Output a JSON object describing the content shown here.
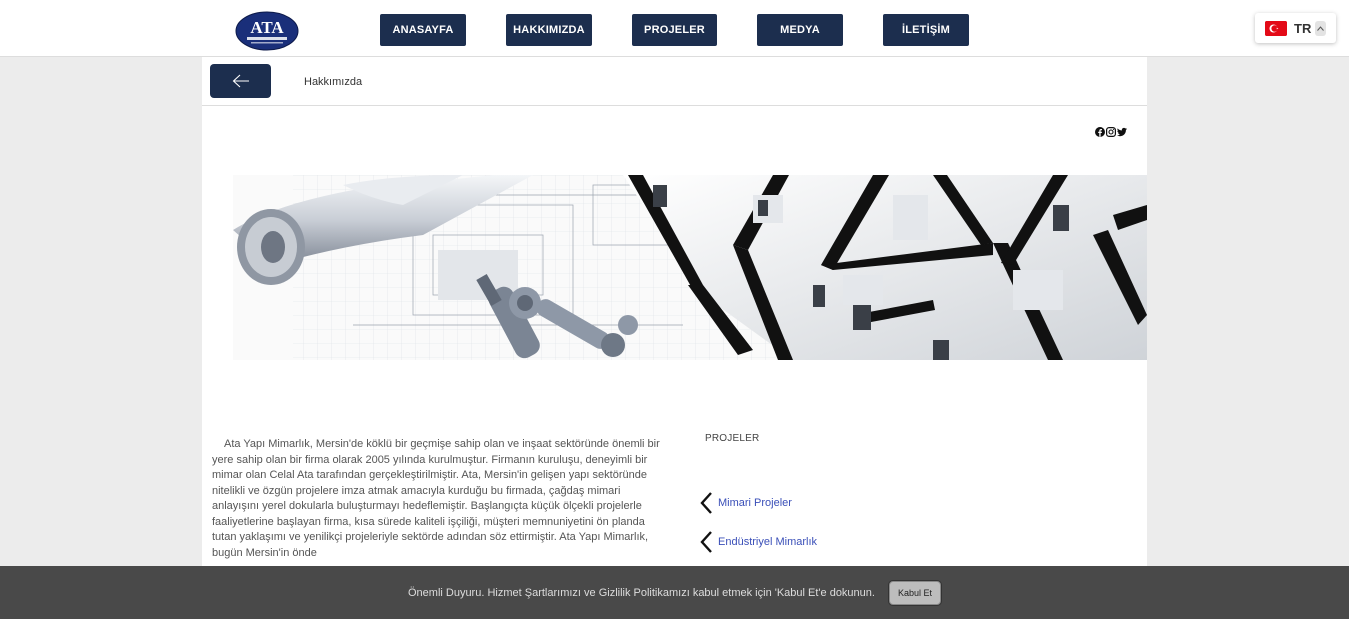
{
  "logo": {
    "text": "ATA",
    "subtext": "YAPI • MİMARLIK"
  },
  "nav": [
    {
      "label": "ANASAYFA"
    },
    {
      "label": "HAKKIMIZDA"
    },
    {
      "label": "PROJELER"
    },
    {
      "label": "MEDYA"
    },
    {
      "label": "İLETİŞİM"
    }
  ],
  "language": {
    "code": "TR",
    "flag": "turkey-flag-icon"
  },
  "breadcrumb": {
    "title": "Hakkımızda"
  },
  "social_icons": [
    "facebook-icon",
    "instagram-icon",
    "twitter-icon"
  ],
  "about": {
    "text": "Ata Yapı Mimarlık, Mersin'de köklü bir geçmişe sahip olan ve inşaat sektöründe önemli bir yere sahip olan bir firma olarak 2005 yılında kurulmuştur. Firmanın kuruluşu, deneyimli bir mimar olan Celal Ata tarafından gerçekleştirilmiştir. Ata, Mersin'in gelişen yapı sektöründe nitelikli ve özgün projelere imza atmak amacıyla kurduğu bu firmada, çağdaş mimari anlayışını yerel dokularla buluşturmayı hedeflemiştir. Başlangıçta küçük ölçekli projelerle faaliyetlerine başlayan firma, kısa sürede kaliteli işçiliği, müşteri memnuniyetini ön planda tutan yaklaşımı ve yenilikçi projeleriyle sektörde adından söz ettirmiştir. Ata Yapı Mimarlık, bugün Mersin'in önde"
  },
  "projects": {
    "title": "PROJELER",
    "links": [
      {
        "label": "Mimari Projeler"
      },
      {
        "label": "Endüstriyel Mimarlık"
      }
    ]
  },
  "cookie": {
    "message": "Önemli Duyuru. Hizmet Şartlarımızı ve Gizlilik Politikamızı kabul etmek için 'Kabul Et'e dokunun.",
    "accept_label": "Kabul Et"
  },
  "colors": {
    "primary": "#1c2e4e",
    "link": "#3a4fb8",
    "cookie_bg": "#494949"
  }
}
